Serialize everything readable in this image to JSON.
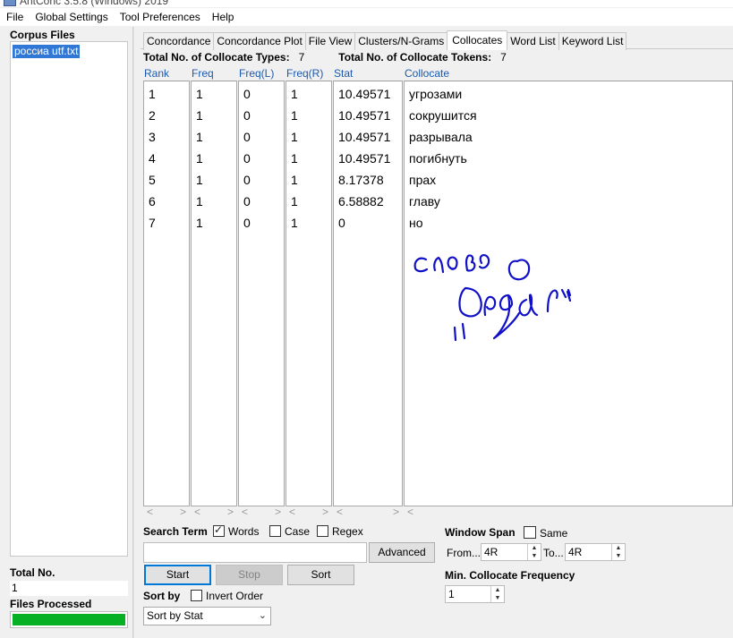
{
  "window": {
    "title": "AntConc 3.5.8 (Windows) 2019"
  },
  "menu": [
    "File",
    "Global Settings",
    "Tool Preferences",
    "Help"
  ],
  "sidebar": {
    "corpus_files_label": "Corpus Files",
    "files": [
      "россиа utf.txt"
    ],
    "total_no_label": "Total No.",
    "total_no_value": "1",
    "files_processed_label": "Files Processed",
    "progress": 1.0
  },
  "tabs": [
    "Concordance",
    "Concordance Plot",
    "File View",
    "Clusters/N-Grams",
    "Collocates",
    "Word List",
    "Keyword List"
  ],
  "active_tab": "Collocates",
  "stats": {
    "types_label": "Total No. of Collocate Types:",
    "types_value": "7",
    "tokens_label": "Total No. of Collocate Tokens:",
    "tokens_value": "7"
  },
  "table": {
    "columns": [
      "Rank",
      "Freq",
      "Freq(L)",
      "Freq(R)",
      "Stat",
      "Collocate"
    ],
    "rows": [
      [
        "1",
        "1",
        "0",
        "1",
        "10.49571",
        "угрозами"
      ],
      [
        "2",
        "1",
        "0",
        "1",
        "10.49571",
        "сокрушится"
      ],
      [
        "3",
        "1",
        "0",
        "1",
        "10.49571",
        "разрывала"
      ],
      [
        "4",
        "1",
        "0",
        "1",
        "10.49571",
        "погибнуть"
      ],
      [
        "5",
        "1",
        "0",
        "1",
        "8.17378",
        "прах"
      ],
      [
        "6",
        "1",
        "0",
        "1",
        "6.58882",
        "главу"
      ],
      [
        "7",
        "1",
        "0",
        "1",
        "0",
        "но"
      ]
    ]
  },
  "search": {
    "label": "Search Term",
    "words_label": "Words",
    "words_checked": true,
    "case_label": "Case",
    "case_checked": false,
    "regex_label": "Regex",
    "regex_checked": false,
    "input_value": "",
    "advanced_label": "Advanced"
  },
  "buttons": {
    "start": "Start",
    "stop": "Stop",
    "sort": "Sort"
  },
  "sort": {
    "label": "Sort by",
    "invert_label": "Invert Order",
    "invert_checked": false,
    "selected": "Sort by Stat"
  },
  "window_span": {
    "label": "Window Span",
    "same_label": "Same",
    "same_checked": false,
    "from_label": "From...",
    "from_value": "4R",
    "to_label": "To...",
    "to_value": "4R"
  },
  "min_freq": {
    "label": "Min. Collocate Frequency",
    "value": "1"
  },
  "colors": {
    "accent": "#3077d6",
    "header_text": "#1c5aaf",
    "progress": "#06b025",
    "ink": "#1010c8"
  }
}
